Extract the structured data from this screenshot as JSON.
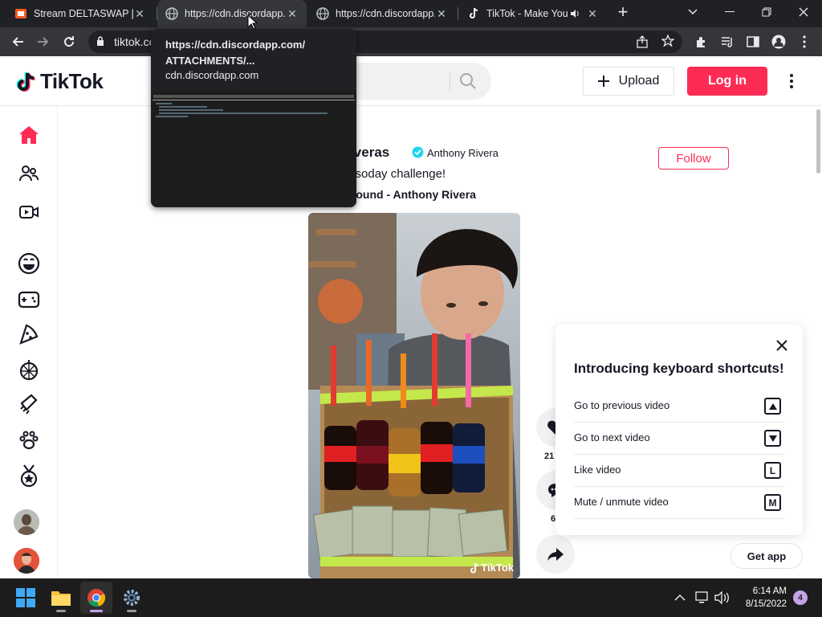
{
  "browser": {
    "tabs": [
      {
        "title": "Stream DELTASWAP [C"
      },
      {
        "title": "https://cdn.discordapp."
      },
      {
        "title": "https://cdn.discordapp."
      },
      {
        "title": "TikTok - Make Your"
      }
    ],
    "new_tab": "+",
    "address": "tiktok.co",
    "hovercard": {
      "title": "https://cdn.discordapp.com/ ATTACHMENTS/...",
      "domain": "cdn.discordapp.com"
    }
  },
  "tiktok": {
    "logo": "TikTok",
    "upload_label": "Upload",
    "login_label": "Log in",
    "post": {
      "author_name": "yriveras",
      "author_nick": "Anthony Rivera",
      "caption": "e soday challenge!",
      "music": "al sound - Anthony Rivera",
      "follow_label": "Follow",
      "watermark": "TikTok",
      "like_count": "21",
      "comment_count": "6"
    },
    "shortcuts": {
      "title": "Introducing keyboard shortcuts!",
      "items": [
        {
          "label": "Go to previous video",
          "key": "▲"
        },
        {
          "label": "Go to next video",
          "key": "▼"
        },
        {
          "label": "Like video",
          "key": "L"
        },
        {
          "label": "Mute / unmute video",
          "key": "M"
        }
      ]
    },
    "get_app": "Get app"
  },
  "taskbar": {
    "time": "6:14 AM",
    "date": "8/15/2022",
    "notification_count": "4"
  },
  "colors": {
    "accent": "#fe2c55",
    "text": "#161823"
  }
}
